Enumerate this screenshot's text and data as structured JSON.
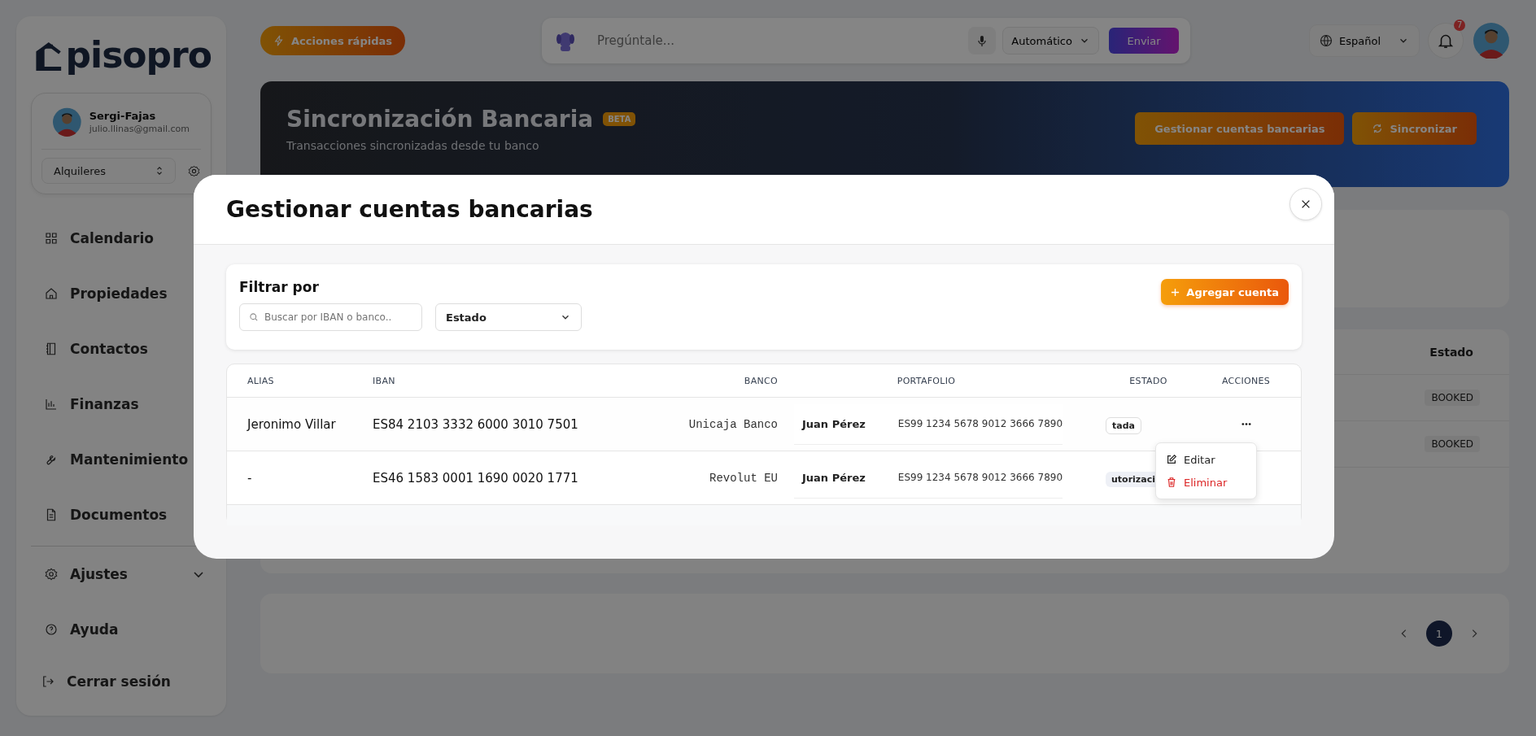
{
  "sidebar": {
    "logo": "pisopro",
    "user": {
      "name": "Sergi-Fajas",
      "email": "julio.llinas@gmail.com"
    },
    "workspace": "Alquileres",
    "nav": [
      {
        "label": "Calendario"
      },
      {
        "label": "Propiedades"
      },
      {
        "label": "Contactos"
      },
      {
        "label": "Finanzas"
      },
      {
        "label": "Mantenimiento"
      },
      {
        "label": "Documentos"
      }
    ],
    "settings": {
      "label": "Ajustes",
      "expanded": false
    },
    "help": "Ayuda",
    "logout": "Cerrar sesión"
  },
  "topbar": {
    "quick_actions": "Acciones rápidas",
    "ask": {
      "placeholder": "Pregúntale..."
    },
    "mode": "Automático",
    "send": "Enviar",
    "language": "Español",
    "notifications": "7"
  },
  "banner": {
    "title": "Sincronización Bancaria",
    "badge": "BETA",
    "subtitle": "Transacciones sincronizadas desde tu banco",
    "buttons": [
      {
        "label": "Gestionar cuentas bancarias",
        "kind": "plain"
      },
      {
        "label": "Sincronizar",
        "kind": "sync"
      }
    ]
  },
  "transactions": {
    "columns": [
      "Estado"
    ],
    "rows": [
      {
        "estado": "BOOKED"
      },
      {
        "estado": "BOOKED"
      }
    ]
  },
  "pagination": {
    "pages": [
      {
        "label": "1",
        "selected": true
      }
    ]
  },
  "modal": {
    "title": "Gestionar cuentas bancarias",
    "filter": {
      "title": "Filtrar por",
      "search": {
        "placeholder": "Buscar por IBAN o banco.."
      },
      "status_select": "Estado",
      "add_button": "Agregar cuenta"
    },
    "table": {
      "columns": [
        "ALIAS",
        "IBAN",
        "BANCO",
        "PORTAFOLIO",
        "ESTADO",
        "ACCIONES"
      ],
      "rows": [
        {
          "alias": "Jeronimo Villar",
          "iban": "ES84 2103 3332 6000 3010 7501",
          "bank": "Unicaja Banco",
          "portfolio_name": "Juan Pérez",
          "portfolio_iban": "ES99 1234 5678 9012 3666 7890",
          "status": {
            "text": "tada",
            "kind": "ok"
          },
          "menu_open": true
        },
        {
          "alias": "-",
          "iban": "ES46 1583 0001 1690 0020 1771",
          "bank": "Revolut EU",
          "portfolio_name": "Juan Pérez",
          "portfolio_iban": "ES99 1234 5678 9012 3666 7890",
          "status": {
            "text": "utorizaci",
            "kind": "pending"
          },
          "menu_open": false
        }
      ]
    },
    "row_menu": [
      {
        "label": "Editar",
        "kind": "edit"
      },
      {
        "label": "Eliminar",
        "kind": "delete"
      }
    ]
  }
}
